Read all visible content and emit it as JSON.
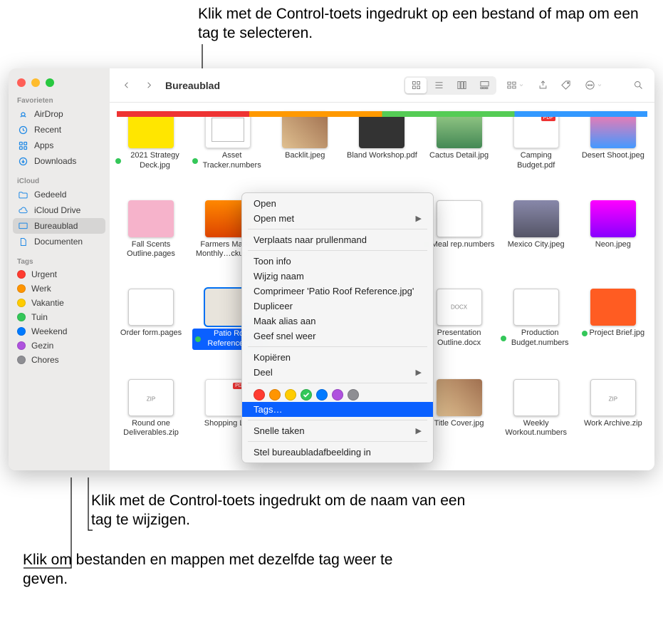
{
  "callouts": {
    "top": "Klik met de Control-toets ingedrukt op een bestand of map om een tag te selecteren.",
    "middle": "Klik met de Control-toets ingedrukt om de naam van een tag te wijzigen.",
    "bottom": "Klik om bestanden en mappen met dezelfde tag weer te geven."
  },
  "sidebar": {
    "favorites_label": "Favorieten",
    "items": [
      {
        "label": "AirDrop"
      },
      {
        "label": "Recent"
      },
      {
        "label": "Apps"
      },
      {
        "label": "Downloads"
      }
    ],
    "icloud_label": "iCloud",
    "icloud_items": [
      {
        "label": "Gedeeld"
      },
      {
        "label": "iCloud Drive"
      },
      {
        "label": "Bureaublad"
      },
      {
        "label": "Documenten"
      }
    ],
    "tags_label": "Tags",
    "tags": [
      {
        "label": "Urgent",
        "color": "#ff3b30"
      },
      {
        "label": "Werk",
        "color": "#ff9500"
      },
      {
        "label": "Vakantie",
        "color": "#ffcc00"
      },
      {
        "label": "Tuin",
        "color": "#34c759"
      },
      {
        "label": "Weekend",
        "color": "#007aff"
      },
      {
        "label": "Gezin",
        "color": "#af52de"
      },
      {
        "label": "Chores",
        "color": "#8e8e93"
      }
    ]
  },
  "toolbar": {
    "title": "Bureaublad"
  },
  "files": [
    {
      "name": "2021 Strategy Deck.jpg",
      "tag": "#34c759"
    },
    {
      "name": "Asset Tracker.numbers",
      "tag": "#34c759"
    },
    {
      "name": "Backlit.jpeg"
    },
    {
      "name": "Bland Workshop.pdf"
    },
    {
      "name": "Cactus Detail.jpg"
    },
    {
      "name": "Camping Budget.pdf"
    },
    {
      "name": "Desert Shoot.jpeg"
    },
    {
      "name": "Fall Scents Outline.pages"
    },
    {
      "name": "Farmers Market Monthly…ckup.jpg"
    },
    {
      "name": ""
    },
    {
      "name": ""
    },
    {
      "name": "Meal rep.numbers",
      "tag": "#34c759"
    },
    {
      "name": "Mexico City.jpeg"
    },
    {
      "name": "Neon.jpeg"
    },
    {
      "name": "Order form.pages"
    },
    {
      "name": "Patio Roof Reference.jpg",
      "tag": "#34c759",
      "selected": true
    },
    {
      "name": ""
    },
    {
      "name": ""
    },
    {
      "name": "Presentation Outline.docx"
    },
    {
      "name": "Production Budget.numbers",
      "tag": "#34c759"
    },
    {
      "name": "Project Brief.jpg",
      "tag": "#34c759"
    },
    {
      "name": "Round one Deliverables.zip"
    },
    {
      "name": "Shopping List"
    },
    {
      "name": ""
    },
    {
      "name": ""
    },
    {
      "name": "Title Cover.jpg"
    },
    {
      "name": "Weekly Workout.numbers"
    },
    {
      "name": "Work Archive.zip"
    }
  ],
  "ctx": {
    "open": "Open",
    "open_with": "Open met",
    "trash": "Verplaats naar prullenmand",
    "info": "Toon info",
    "rename": "Wijzig naam",
    "compress": "Comprimeer 'Patio Roof Reference.jpg'",
    "duplicate": "Dupliceer",
    "alias": "Maak alias aan",
    "quicklook": "Geef snel weer",
    "copy": "Kopiëren",
    "share": "Deel",
    "tags": "Tags…",
    "quick": "Snelle taken",
    "wallpaper": "Stel bureaubladafbeelding in",
    "tag_colors": [
      "#ff3b30",
      "#ff9500",
      "#ffcc00",
      "#34c759",
      "#007aff",
      "#af52de",
      "#8e8e93"
    ],
    "tag_checked_index": 3
  }
}
